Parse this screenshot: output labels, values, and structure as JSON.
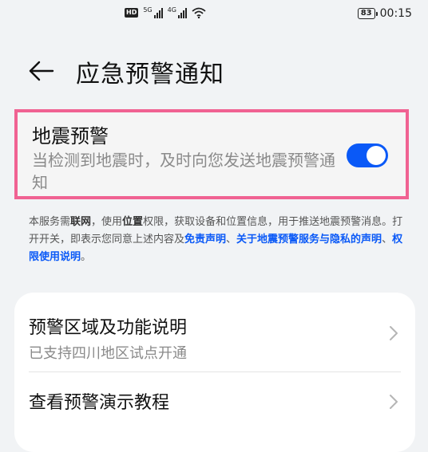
{
  "status_bar": {
    "hd_label": "HD",
    "signal1_label": "5G",
    "signal2_label": "4G",
    "battery": "83",
    "time": "00:15"
  },
  "header": {
    "title": "应急预警通知"
  },
  "earthquake": {
    "title": "地震预警",
    "description": "当检测到地震时，及时向您发送地震预警通知",
    "toggle_on": true
  },
  "notice": {
    "p1": "本服务需",
    "b1": "联网",
    "p2": "，使用",
    "b2": "位置",
    "p3": "权限，获取设备和位置信息，用于推送地震预警消息。打开开关，即表示您同意上述内容及",
    "link1": "免责声明",
    "sep1": "、",
    "link2": "关于地震预警服务与隐私的声明",
    "sep2": "、",
    "link3": "权限使用说明",
    "end": "。"
  },
  "options": {
    "item1_title": "预警区域及功能说明",
    "item1_subtitle": "已支持四川地区试点开通",
    "item2_title": "查看预警演示教程"
  },
  "colors": {
    "accent": "#0a59f7",
    "highlight": "#f06292",
    "background": "#f1f3f5"
  },
  "icons": {
    "back": "arrow-left-icon",
    "chevron": "chevron-right-icon",
    "wifi": "wifi-icon"
  }
}
